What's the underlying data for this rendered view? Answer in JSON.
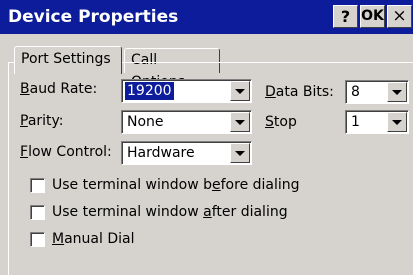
{
  "window": {
    "title": "Device Properties",
    "help_label": "?",
    "ok_label": "OK",
    "close_label": "×"
  },
  "tabs": [
    {
      "label": "Port Settings",
      "active": true
    },
    {
      "label": "Call Options",
      "active": false
    }
  ],
  "fields": {
    "baud_rate": {
      "label_prefix": "B",
      "label_rest": "aud Rate:",
      "value": "19200"
    },
    "parity": {
      "label_prefix": "P",
      "label_rest": "arity:",
      "value": "None"
    },
    "flow_control": {
      "label_prefix": "F",
      "label_rest": "low Control:",
      "value": "Hardware"
    },
    "data_bits": {
      "label_prefix": "D",
      "label_rest": "ata Bits:",
      "value": "8"
    },
    "stop": {
      "label_prefix": "S",
      "label_rest": "top",
      "value": "1"
    }
  },
  "checkboxes": [
    {
      "pre": "Use terminal window b",
      "accel": "e",
      "post": "fore dialing",
      "checked": false
    },
    {
      "pre": "Use terminal window ",
      "accel": "a",
      "post": "fter dialing",
      "checked": false
    },
    {
      "pre": "",
      "accel": "M",
      "post": "anual Dial",
      "checked": false
    }
  ],
  "colors": {
    "titlebar": "#0c1c9a",
    "face": "#d6d3ce",
    "selection": "#0c1c9a"
  }
}
